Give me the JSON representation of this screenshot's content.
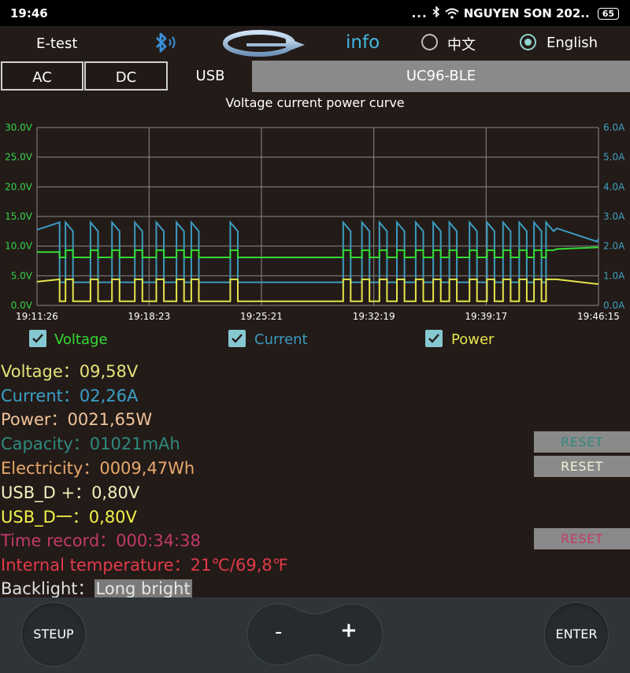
{
  "status_bar": {
    "time": "19:46",
    "indicators": "...",
    "carrier": "NGUYEN SON 202..",
    "battery": "65",
    "icons": [
      "bluetooth-icon",
      "wifi-icon",
      "battery-icon"
    ]
  },
  "header": {
    "device_label": "E-test",
    "info_label": "info",
    "lang_options": [
      {
        "label": "中文",
        "selected": false
      },
      {
        "label": "English",
        "selected": true
      }
    ]
  },
  "tabs": [
    {
      "label": "AC",
      "active": false
    },
    {
      "label": "DC",
      "active": false
    },
    {
      "label": "USB",
      "active": true
    },
    {
      "label": "UC96-BLE",
      "active": false
    }
  ],
  "chart_data": {
    "type": "line",
    "title": "Voltage current power curve",
    "x_ticks": [
      "19:11:26",
      "19:18:23",
      "19:25:21",
      "19:32:19",
      "19:39:17",
      "19:46:15"
    ],
    "y_left_ticks": [
      "0.0V",
      "5.0V",
      "10.0V",
      "15.0V",
      "20.0V",
      "25.0V",
      "30.0V"
    ],
    "y_right_ticks": [
      "0.0A",
      "1.0A",
      "2.0A",
      "3.0A",
      "4.0A",
      "5.0A",
      "6.0A"
    ],
    "y_left_range": [
      0,
      30
    ],
    "y_right_range": [
      0,
      6
    ],
    "grid": true,
    "series": [
      {
        "name": "Voltage",
        "color": "#33dd33",
        "axis": "left",
        "baseline": 9.0,
        "dip": 8.1,
        "pulse_level": 9.3
      },
      {
        "name": "Current",
        "color": "#3b9bc0",
        "axis": "right",
        "baseline": 0.78,
        "pulse_level": 2.8,
        "idle_level": 2.55,
        "tail_level": 2.25
      },
      {
        "name": "Power",
        "color": "#e5e54a",
        "axis": "left",
        "baseline": 0.7,
        "pulse_level": 4.4,
        "tail_level": 4.0
      }
    ],
    "pulse_times": [
      "19:11:26",
      "19:13:12",
      "19:14:45",
      "19:16:05",
      "19:17:30",
      "19:18:50",
      "19:20:05",
      "19:21:00",
      "19:23:25",
      "19:30:25",
      "19:31:35",
      "19:32:40",
      "19:33:45",
      "19:34:55",
      "19:36:00",
      "19:37:00",
      "19:38:15",
      "19:39:20",
      "19:40:20",
      "19:41:20",
      "19:42:15",
      "19:43:00"
    ]
  },
  "legend": [
    {
      "label": "Voltage",
      "checked": true,
      "color": "#33dd33"
    },
    {
      "label": "Current",
      "checked": true,
      "color": "#3b9bc0"
    },
    {
      "label": "Power",
      "checked": true,
      "color": "#e5e54a"
    }
  ],
  "readings": {
    "voltage": {
      "label": "Voltage：",
      "value": "09,58V",
      "color": "#e6e27a"
    },
    "current": {
      "label": "Current：",
      "value": "02,26A",
      "color": "#3aa0c8"
    },
    "power": {
      "label": "Power：",
      "value": "0021,65W",
      "color": "#f0c49a"
    },
    "capacity": {
      "label": "Capacity：",
      "value": "01021mAh",
      "color": "#2e8a7e"
    },
    "electricity": {
      "label": "Electricity：",
      "value": "0009,47Wh",
      "color": "#e8a86a"
    },
    "usb_dp": {
      "label": "USB_D +：",
      "value": "0,80V",
      "color": "#f0f0c0"
    },
    "usb_dm": {
      "label": "USB_D一：",
      "value": "0,80V",
      "color": "#f2f24a"
    },
    "time_record": {
      "label": "Time record：",
      "value": "000:34:38",
      "color": "#c23a6b"
    },
    "temperature": {
      "label": "Internal temperature：",
      "value": "21℃/69,8℉",
      "color": "#e23a4a"
    },
    "backlight": {
      "label": "Backlight：",
      "value": "Long bright",
      "color": "#e0e0e0"
    }
  },
  "reset_buttons": {
    "capacity": {
      "label": "RESET",
      "color": "#2e8a7e"
    },
    "electricity": {
      "label": "RESET",
      "color": "#f0f0d8"
    },
    "time": {
      "label": "RESET",
      "color": "#c23a6b"
    }
  },
  "bottom": {
    "setup": "STEUP",
    "minus": "-",
    "plus": "+",
    "enter": "ENTER"
  }
}
